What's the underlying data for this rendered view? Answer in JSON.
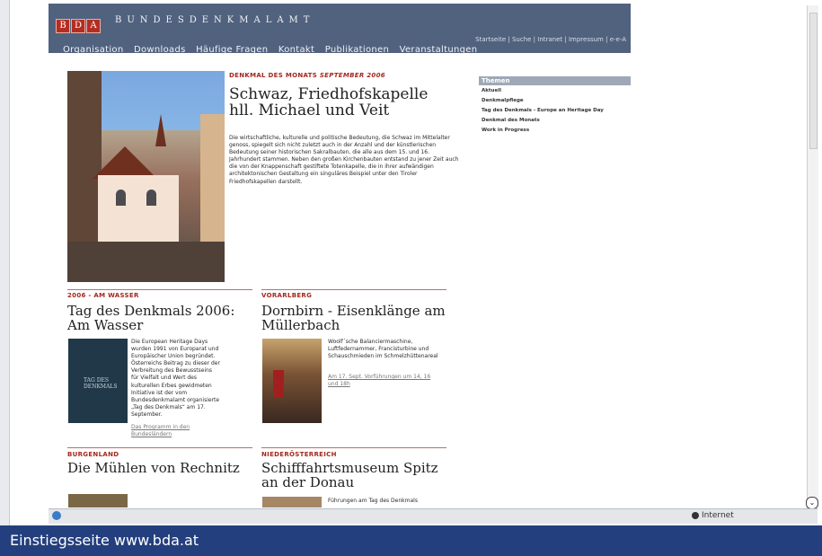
{
  "header": {
    "logo_letters": [
      "B",
      "D",
      "A"
    ],
    "brand": "BUNDESDENKMALAMT",
    "util_links": "Startseite | Suche | Intranet | Impressum | e-e-A",
    "nav": [
      "Organisation",
      "Downloads",
      "Häufige Fragen",
      "Kontakt",
      "Publikationen",
      "Veranstaltungen"
    ]
  },
  "feature": {
    "label_prefix": "DENKMAL DES MONATS",
    "label_emph": "SEPTEMBER 2006",
    "title": "Schwaz, Friedhofskapelle hll. Michael und Veit",
    "text": "Die wirtschaftliche, kulturelle und politische Bedeutung, die Schwaz im Mittelalter genoss, spiegelt sich nicht zuletzt auch in der Anzahl und der künstlerischen Bedeutung seiner historischen Sakralbauten, die alle aus dem 15. und 16. Jahrhundert stammen. Neben den großen Kirchenbauten entstand zu jener Zeit auch die von der Knappenschaft gestiftete Totenkapelle, die in ihrer aufwändigen architektonischen Gestaltung ein singuläres Beispiel unter den Tiroler Friedhofskapellen darstellt."
  },
  "themes": {
    "title": "Themen",
    "items": [
      "Aktuell",
      "Denkmalpflege",
      "Tag des Denkmals - Europe an Heritage Day",
      "Denkmal des Monats",
      "Work in Progress"
    ]
  },
  "articles": [
    {
      "label": "2006 - AM WASSER",
      "title": "Tag des Denkmals 2006: Am Wasser",
      "text": "Die European Heritage Days wurden 1991 von Europarat und Europäischer Union begründet. Österreichs Beitrag zu dieser der Verbreitung des Bewusstseins für Vielfalt und Wert des kulturellen Erbes gewidmeten Initiative ist der vom Bundesdenkmalamt organisierte „Tag des Denkmals“ am 17. September.",
      "link": "Das Programm in den Bundesländern",
      "image_text": "TAG DES DENKMALS"
    },
    {
      "label": "VORARLBERG",
      "title": "Dornbirn - Eisenklänge am Müllerbach",
      "text": "Woolf´sche Balanciermaschine, Luftfedernammer, Francisturbine und Schauschmieden im Schmelzhüttenareal",
      "link": "Am 17. Sept. Vorführungen um 14, 16 und 18h"
    },
    {
      "label": "BURGENLAND",
      "title": "Die Mühlen von Rechnitz"
    },
    {
      "label": "NIEDERÖSTERREICH",
      "title": "Schifffahrtsmuseum Spitz an der Donau",
      "text": "Führungen am Tag des Denkmals"
    }
  ],
  "status": {
    "zone": "Internet"
  },
  "caption": "Einstiegsseite www.bda.at"
}
